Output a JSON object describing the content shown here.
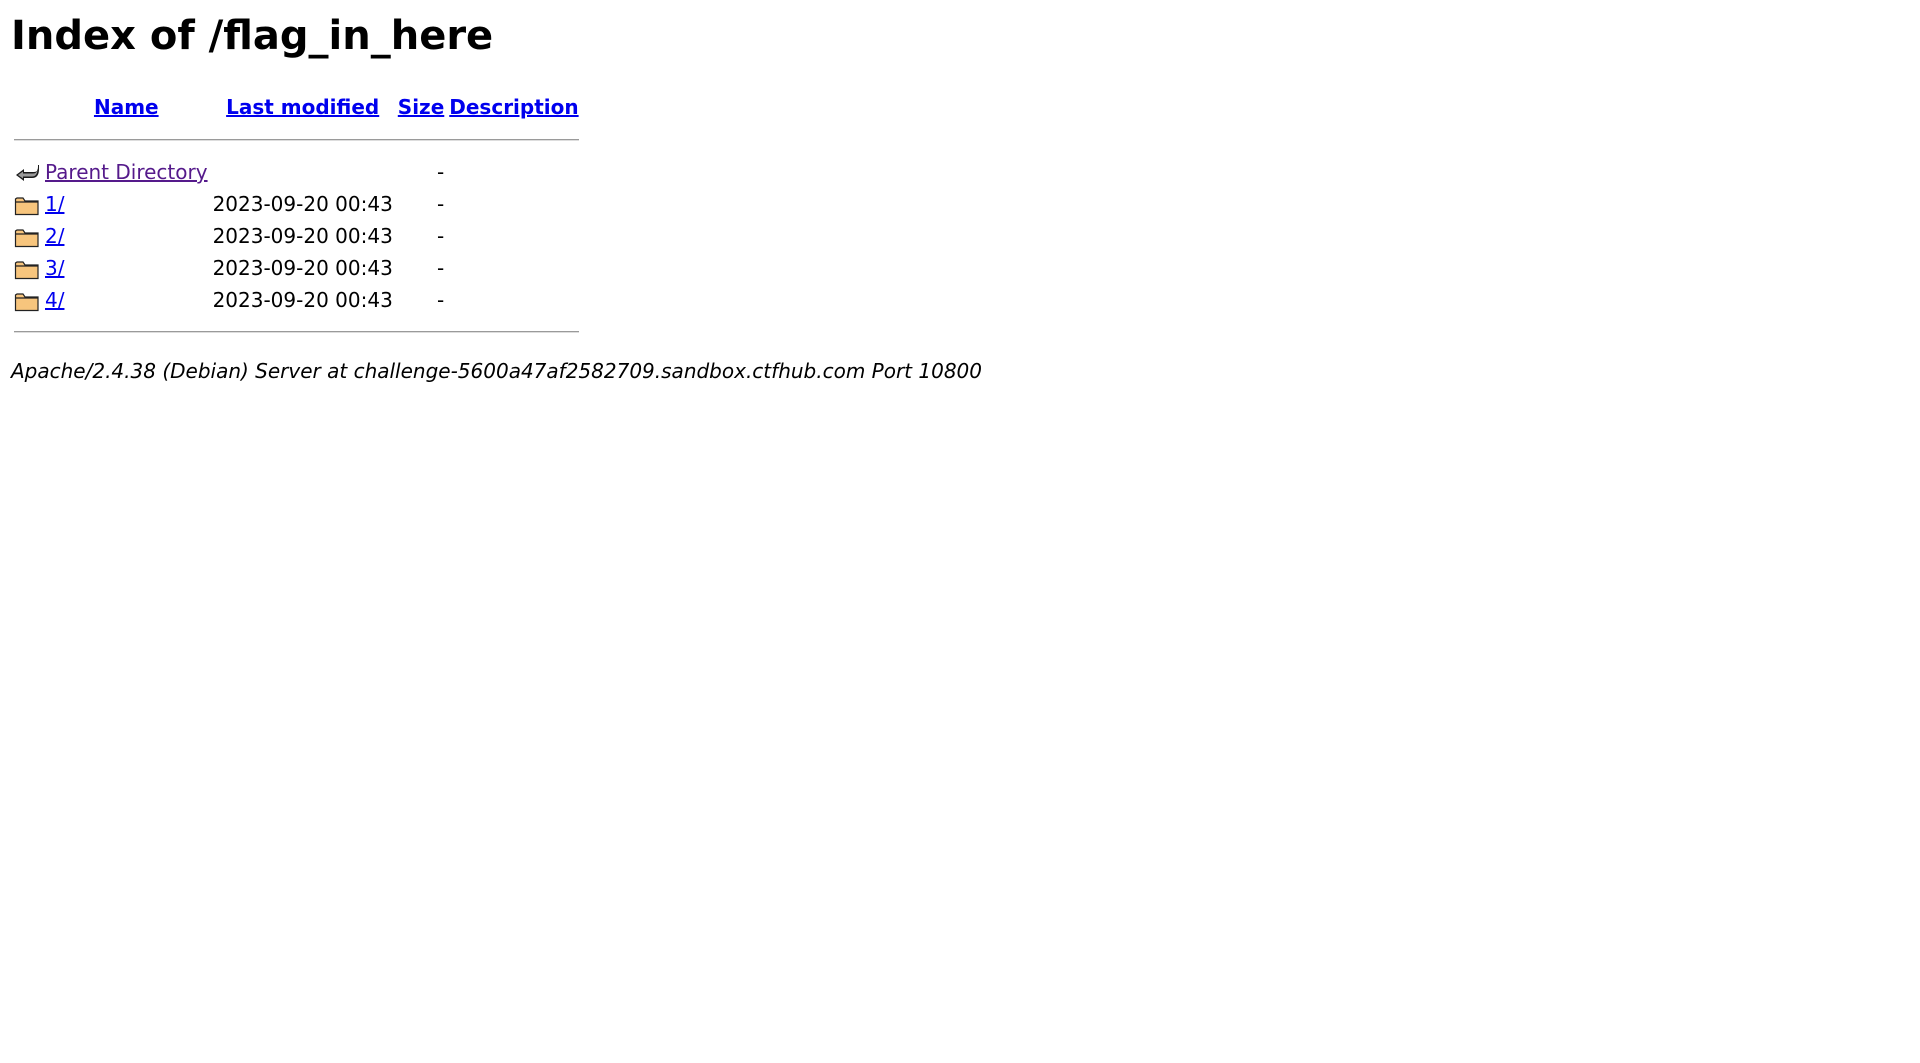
{
  "page": {
    "title": "Index of /flag_in_here"
  },
  "table": {
    "headers": {
      "name": "Name",
      "last_modified": "Last modified",
      "size": "Size",
      "description": "Description"
    },
    "rows": [
      {
        "icon": "back-arrow-icon",
        "name": "Parent Directory",
        "last_modified": "",
        "size": "-",
        "description": ""
      },
      {
        "icon": "folder-icon",
        "name": "1/",
        "last_modified": "2023-09-20 00:43",
        "size": "-",
        "description": ""
      },
      {
        "icon": "folder-icon",
        "name": "2/",
        "last_modified": "2023-09-20 00:43",
        "size": "-",
        "description": ""
      },
      {
        "icon": "folder-icon",
        "name": "3/",
        "last_modified": "2023-09-20 00:43",
        "size": "-",
        "description": ""
      },
      {
        "icon": "folder-icon",
        "name": "4/",
        "last_modified": "2023-09-20 00:43",
        "size": "-",
        "description": ""
      }
    ]
  },
  "footer": {
    "address": "Apache/2.4.38 (Debian) Server at challenge-5600a47af2582709.sandbox.ctfhub.com Port 10800"
  },
  "colors": {
    "link": "#0000ee",
    "visited_link": "#551a8b",
    "folder_fill": "#f7c57d"
  }
}
